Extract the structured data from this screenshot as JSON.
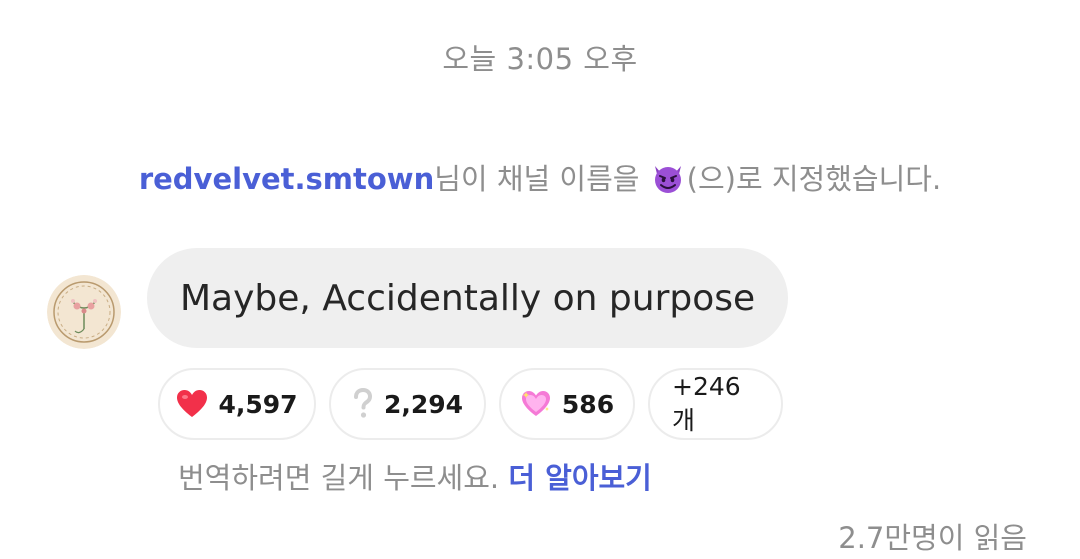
{
  "timestamp": "오늘 3:05 오후",
  "system_message": {
    "username": "redvelvet.smtown",
    "prefix_text": "님이 채널 이름을 ",
    "channel_name_icon": "smiling-devil-emoji",
    "suffix_text": "(으)로 지정했습니다."
  },
  "message": {
    "avatar_icon": "floral-wreath-avatar",
    "text": "Maybe, Accidentally on purpose"
  },
  "reactions": [
    {
      "icon": "red-heart-emoji",
      "count": "4,597"
    },
    {
      "icon": "white-question-mark-emoji",
      "count": "2,294"
    },
    {
      "icon": "sparkling-heart-emoji",
      "count": "586"
    },
    {
      "icon": "",
      "count": "+246개"
    }
  ],
  "translate_hint": {
    "text": "번역하려면 길게 누르세요.",
    "link": "더 알아보기"
  },
  "read_count": "2.7만명이 읽음",
  "colors": {
    "accent_link": "#4a5fd6",
    "muted_text": "#8e8e8e",
    "bubble_bg": "#efefef"
  }
}
